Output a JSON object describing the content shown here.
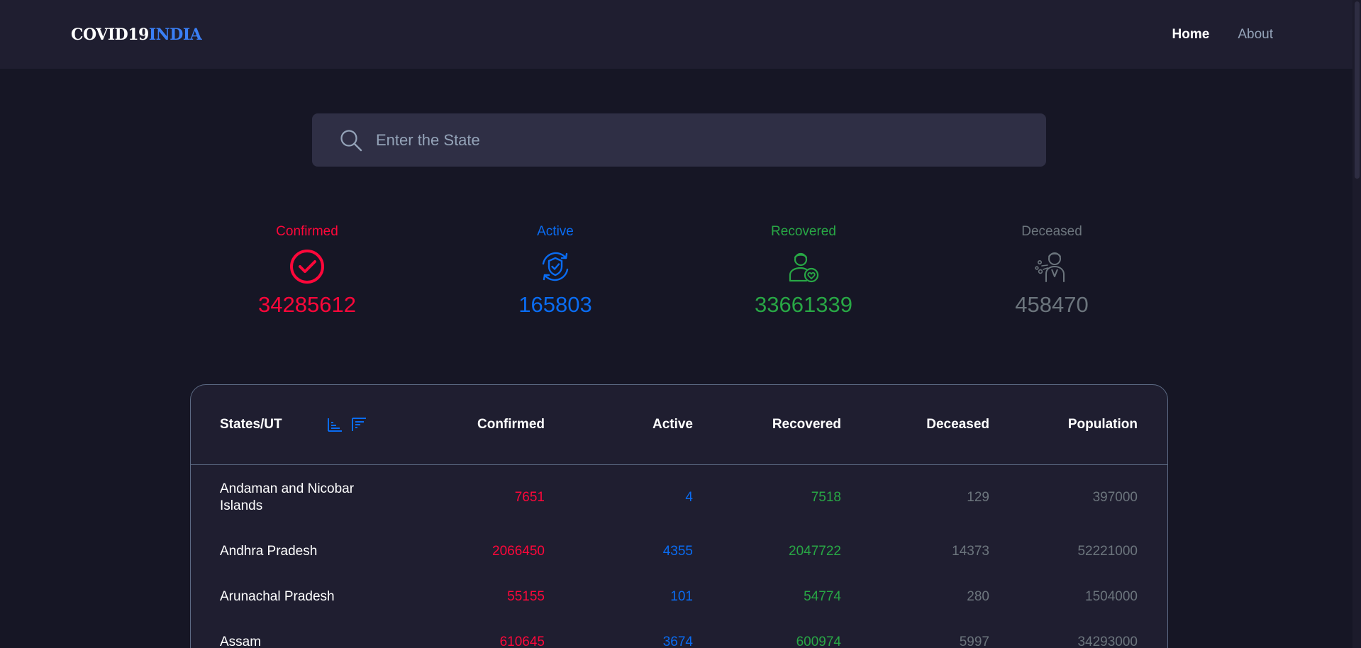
{
  "header": {
    "logo_part1": "COVID19",
    "logo_part2": "INDIA",
    "nav": {
      "home": "Home",
      "about": "About"
    }
  },
  "search": {
    "placeholder": "Enter the State",
    "value": "",
    "icon": "search-icon"
  },
  "stats": [
    {
      "label": "Confirmed",
      "value": "34285612",
      "icon": "check-circle-icon",
      "color": "#ff073a"
    },
    {
      "label": "Active",
      "value": "165803",
      "icon": "shield-refresh-icon",
      "color": "#0a6cf2"
    },
    {
      "label": "Recovered",
      "value": "33661339",
      "icon": "person-heart-icon",
      "color": "#28a745"
    },
    {
      "label": "Deceased",
      "value": "458470",
      "icon": "person-breath-icon",
      "color": "#6c757d"
    }
  ],
  "table": {
    "columns": {
      "state": "States/UT",
      "confirmed": "Confirmed",
      "active": "Active",
      "recovered": "Recovered",
      "deceased": "Deceased",
      "population": "Population"
    },
    "sort_icons": [
      "sort-ascending-icon",
      "sort-descending-icon"
    ],
    "rows": [
      {
        "state": "Andaman and Nicobar Islands",
        "confirmed": "7651",
        "active": "4",
        "recovered": "7518",
        "deceased": "129",
        "population": "397000"
      },
      {
        "state": "Andhra Pradesh",
        "confirmed": "2066450",
        "active": "4355",
        "recovered": "2047722",
        "deceased": "14373",
        "population": "52221000"
      },
      {
        "state": "Arunachal Pradesh",
        "confirmed": "55155",
        "active": "101",
        "recovered": "54774",
        "deceased": "280",
        "population": "1504000"
      },
      {
        "state": "Assam",
        "confirmed": "610645",
        "active": "3674",
        "recovered": "600974",
        "deceased": "5997",
        "population": "34293000"
      }
    ]
  },
  "colors": {
    "confirmed": "#ff073a",
    "active": "#0a6cf2",
    "recovered": "#28a745",
    "deceased": "#6c757d",
    "brand_accent": "#3a7ff6"
  }
}
